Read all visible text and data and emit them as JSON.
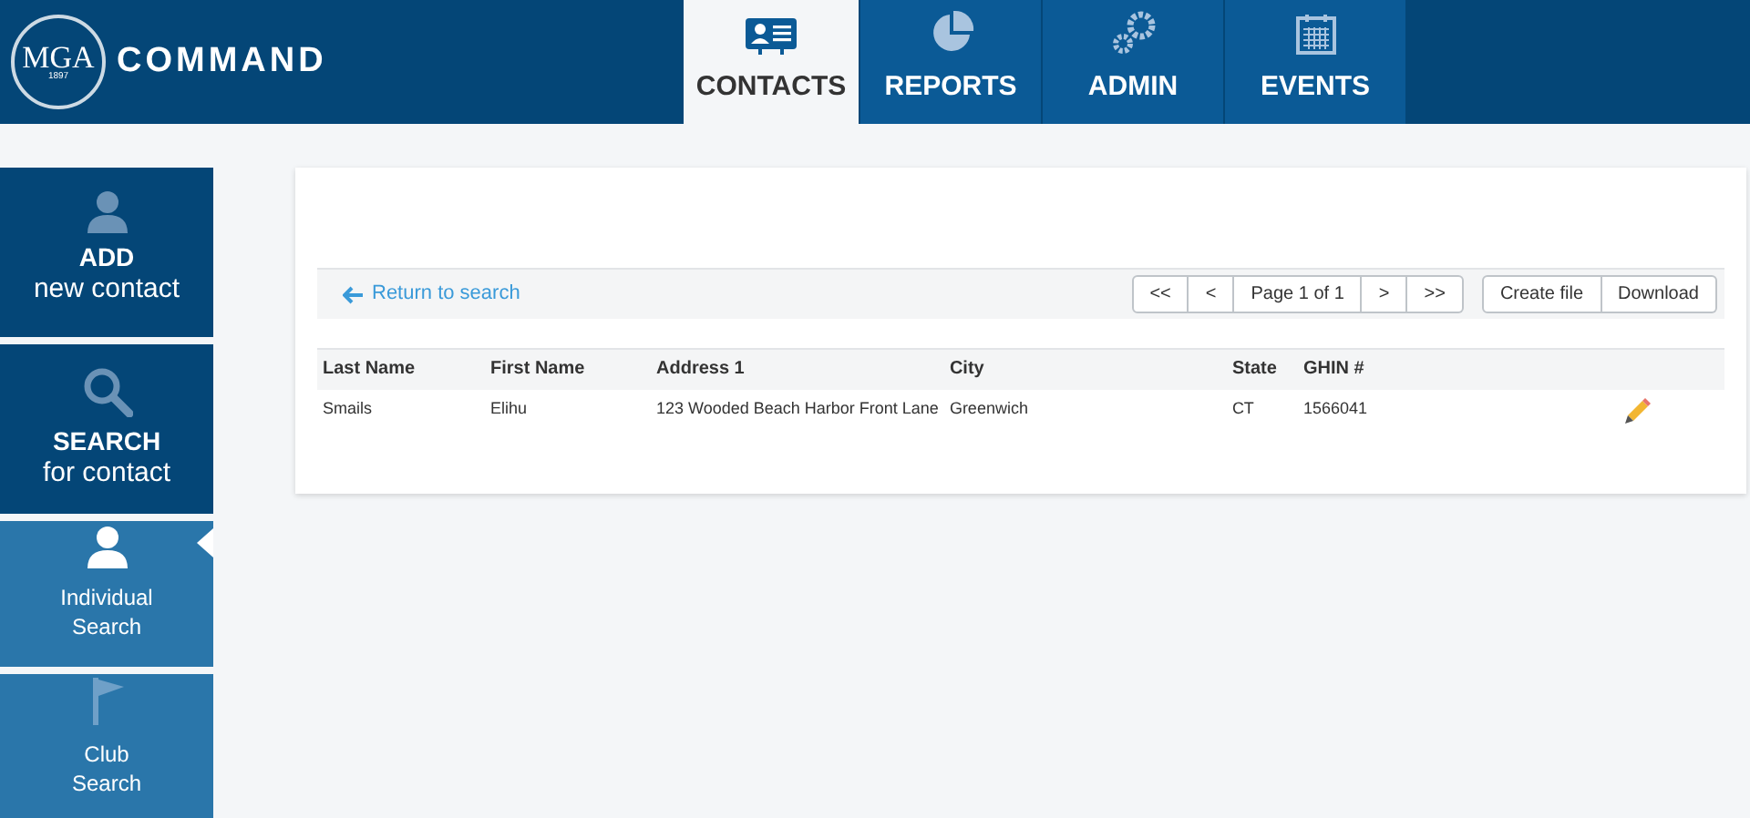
{
  "logo": {
    "mark": "MGA",
    "year": "1897",
    "title": "COMMAND"
  },
  "nav_tabs": [
    {
      "label": "CONTACTS",
      "selected": true
    },
    {
      "label": "REPORTS",
      "selected": false
    },
    {
      "label": "ADMIN",
      "selected": false
    },
    {
      "label": "EVENTS",
      "selected": false
    }
  ],
  "sidebar": {
    "items": [
      {
        "kind": "primary",
        "title": "ADD",
        "subtitle": "new contact",
        "selected": false
      },
      {
        "kind": "primary",
        "title": "SEARCH",
        "subtitle": "for contact",
        "selected": false
      },
      {
        "kind": "secondary",
        "title": "Individual",
        "subtitle": "Search",
        "selected": true
      },
      {
        "kind": "secondary",
        "title": "Club",
        "subtitle": "Search",
        "selected": false
      }
    ]
  },
  "toolbar": {
    "return_link": "Return to search",
    "pager": [
      "<<",
      "<",
      "Page 1 of 1",
      ">",
      ">>"
    ],
    "actions": [
      "Create file",
      "Download"
    ]
  },
  "table": {
    "columns": [
      "Last Name",
      "First Name",
      "Address 1",
      "City",
      "State",
      "GHIN #"
    ],
    "rows": [
      {
        "cells": [
          "Smails",
          "Elihu",
          "123 Wooded Beach Harbor Front Lane",
          "Greenwich",
          "CT",
          "1566041"
        ]
      }
    ]
  }
}
